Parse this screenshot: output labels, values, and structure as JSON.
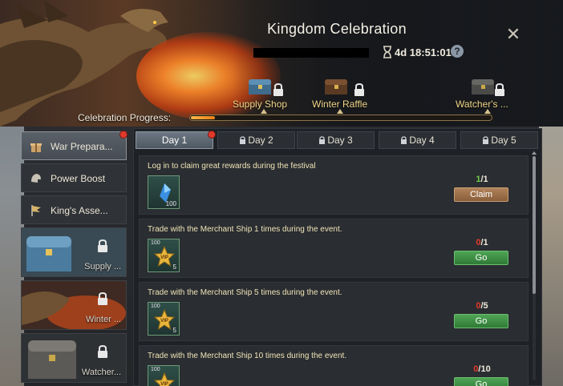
{
  "header": {
    "title": "Kingdom Celebration",
    "timer": "4d 18:51:01",
    "help_icon": "?",
    "close_icon": "✕"
  },
  "milestones": [
    {
      "label": "Supply Shop",
      "icon": "chest-icon"
    },
    {
      "label": "Winter Raffle",
      "icon": "chest-icon"
    },
    {
      "label": "Watcher's ...",
      "icon": "chest-icon"
    }
  ],
  "progress": {
    "label": "Celebration Progress:",
    "fraction": 0.08
  },
  "sidebar": {
    "items": [
      {
        "label": "War Prepara...",
        "icon": "gift-icon"
      },
      {
        "label": "Power Boost",
        "icon": "helmet-icon"
      },
      {
        "label": "King's Asse...",
        "icon": "flag-icon"
      }
    ],
    "image_items": [
      {
        "label": "Supply ..."
      },
      {
        "label": "Winter ..."
      },
      {
        "label": "Watcher..."
      }
    ]
  },
  "tabs": [
    {
      "label": "Day 1"
    },
    {
      "label": "Day 2"
    },
    {
      "label": "Day 3"
    },
    {
      "label": "Day 4"
    },
    {
      "label": "Day 5"
    }
  ],
  "tasks": [
    {
      "desc": "Log in to claim great rewards during the festival",
      "reward_icon": "blue-crystal-icon",
      "reward_top": "",
      "reward_qty": "100",
      "current": "1",
      "total": "/1",
      "button": "Claim"
    },
    {
      "desc": "Trade with the Merchant Ship 1 times during the event.",
      "reward_icon": "vip-star-icon",
      "reward_top": "100",
      "reward_qty": "5",
      "current": "0",
      "total": "/1",
      "button": "Go"
    },
    {
      "desc": "Trade with the Merchant Ship 5 times during the event.",
      "reward_icon": "vip-star-icon",
      "reward_top": "100",
      "reward_qty": "5",
      "current": "0",
      "total": "/5",
      "button": "Go"
    },
    {
      "desc": "Trade with the Merchant Ship 10 times during the event.",
      "reward_icon": "vip-star-icon",
      "reward_top": "100",
      "reward_qty": "",
      "current": "0",
      "total": "/10",
      "button": "Go"
    }
  ],
  "colors": {
    "complete": "#6fd04a",
    "incomplete": "#e0392b",
    "vip_gold": "#e9b63c"
  }
}
